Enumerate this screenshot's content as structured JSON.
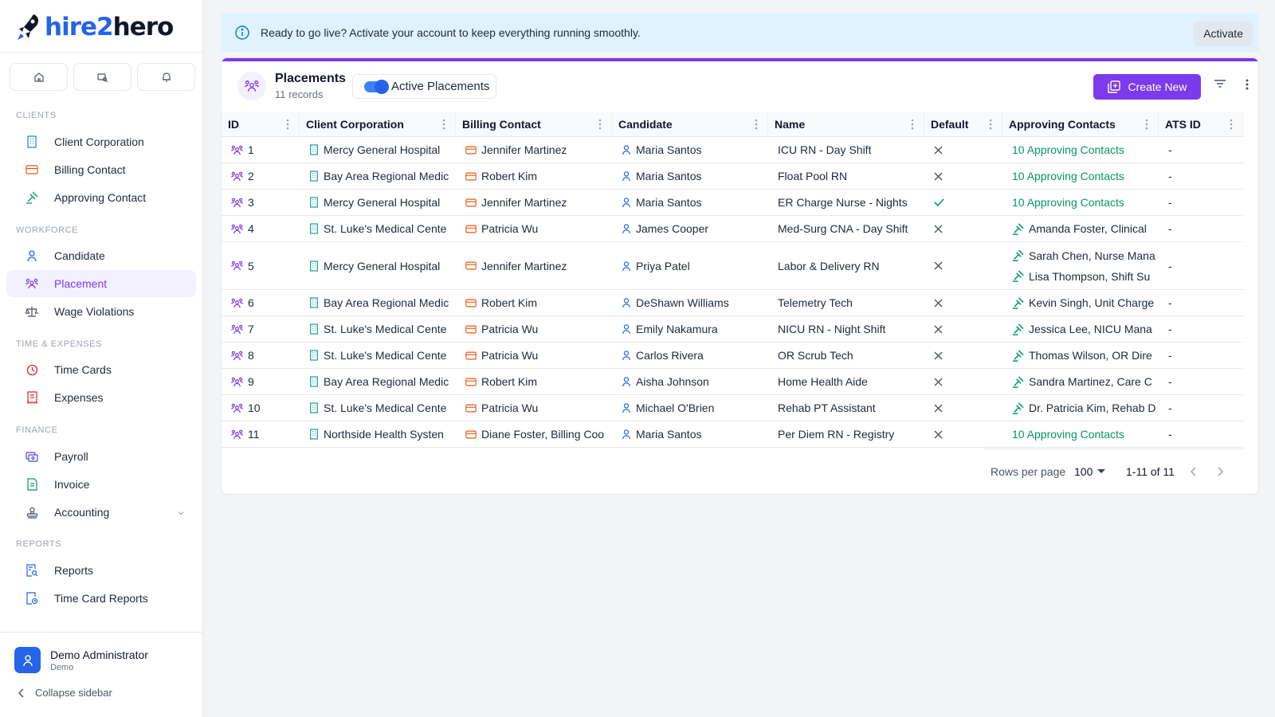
{
  "brand": {
    "name_part1": "hire",
    "name_part2": "2",
    "name_part3": "hero"
  },
  "quick_actions": [
    "home-icon",
    "search-icon",
    "bell-icon"
  ],
  "sidebar": {
    "sections": [
      {
        "label": "CLIENTS",
        "items": [
          {
            "label": "Client Corporation",
            "icon": "building-icon",
            "color": "#0d9488"
          },
          {
            "label": "Billing Contact",
            "icon": "credit-card-icon",
            "color": "#ea580c"
          },
          {
            "label": "Approving Contact",
            "icon": "approval-icon",
            "color": "#059669"
          }
        ]
      },
      {
        "label": "WORKFORCE",
        "items": [
          {
            "label": "Candidate",
            "icon": "user-icon",
            "color": "#2563eb"
          },
          {
            "label": "Placement",
            "icon": "users-icon",
            "color": "#7c3aed",
            "active": true
          },
          {
            "label": "Wage Violations",
            "icon": "scale-icon",
            "color": "#4b5563"
          }
        ]
      },
      {
        "label": "TIME & EXPENSES",
        "items": [
          {
            "label": "Time Cards",
            "icon": "clock-icon",
            "color": "#dc2626"
          },
          {
            "label": "Expenses",
            "icon": "receipt-icon",
            "color": "#dc2626"
          }
        ]
      },
      {
        "label": "FINANCE",
        "items": [
          {
            "label": "Payroll",
            "icon": "payroll-icon",
            "color": "#4f46e5"
          },
          {
            "label": "Invoice",
            "icon": "invoice-icon",
            "color": "#059669"
          },
          {
            "label": "Accounting",
            "icon": "stamp-icon",
            "color": "#4b5563"
          }
        ]
      },
      {
        "label": "REPORTS",
        "items": [
          {
            "label": "Reports",
            "icon": "report-icon",
            "color": "#2563eb"
          },
          {
            "label": "Time Card Reports",
            "icon": "timecard-report-icon",
            "color": "#2563eb"
          }
        ]
      }
    ],
    "user": {
      "name": "Demo Administrator",
      "role": "Demo"
    },
    "collapse_label": "Collapse sidebar"
  },
  "banner": {
    "message": "Ready to go live? Activate your account to keep everything running smoothly.",
    "button": "Activate"
  },
  "page": {
    "title": "Placements",
    "subtitle": "11 records",
    "toggle_label": "Active Placements",
    "toggle_on": true,
    "create_button": "Create New"
  },
  "table": {
    "columns": [
      "ID",
      "Client Corporation",
      "Billing Contact",
      "Candidate",
      "Name",
      "Default",
      "Approving Contacts",
      "ATS ID"
    ],
    "rows": [
      {
        "id": "1",
        "client": "Mercy General Hospital",
        "billing": "Jennifer Martinez",
        "candidate": "Maria Santos",
        "name": "ICU RN - Day Shift",
        "default": false,
        "approving": [
          "10 Approving Contacts"
        ],
        "approving_is_link": true,
        "ats": "-"
      },
      {
        "id": "2",
        "client": "Bay Area Regional Medic",
        "billing": "Robert Kim",
        "candidate": "Maria Santos",
        "name": "Float Pool RN",
        "default": false,
        "approving": [
          "10 Approving Contacts"
        ],
        "approving_is_link": true,
        "ats": "-"
      },
      {
        "id": "3",
        "client": "Mercy General Hospital",
        "billing": "Jennifer Martinez",
        "candidate": "Maria Santos",
        "name": "ER Charge Nurse - Nights",
        "default": true,
        "approving": [
          "10 Approving Contacts"
        ],
        "approving_is_link": true,
        "ats": "-"
      },
      {
        "id": "4",
        "client": "St. Luke's Medical Cente",
        "billing": "Patricia Wu",
        "candidate": "James Cooper",
        "name": "Med-Surg CNA - Day Shift",
        "default": false,
        "approving": [
          "Amanda Foster, Clinical"
        ],
        "approving_is_link": false,
        "ats": "-"
      },
      {
        "id": "5",
        "client": "Mercy General Hospital",
        "billing": "Jennifer Martinez",
        "candidate": "Priya Patel",
        "name": "Labor & Delivery RN",
        "default": false,
        "approving": [
          "Sarah Chen, Nurse Mana",
          "Lisa Thompson, Shift Su"
        ],
        "approving_is_link": false,
        "ats": "-"
      },
      {
        "id": "6",
        "client": "Bay Area Regional Medic",
        "billing": "Robert Kim",
        "candidate": "DeShawn Williams",
        "name": "Telemetry Tech",
        "default": false,
        "approving": [
          "Kevin Singh, Unit Charge"
        ],
        "approving_is_link": false,
        "ats": "-"
      },
      {
        "id": "7",
        "client": "St. Luke's Medical Cente",
        "billing": "Patricia Wu",
        "candidate": "Emily Nakamura",
        "name": "NICU RN - Night Shift",
        "default": false,
        "approving": [
          "Jessica Lee, NICU Mana"
        ],
        "approving_is_link": false,
        "ats": "-"
      },
      {
        "id": "8",
        "client": "St. Luke's Medical Cente",
        "billing": "Patricia Wu",
        "candidate": "Carlos Rivera",
        "name": "OR Scrub Tech",
        "default": false,
        "approving": [
          "Thomas Wilson, OR Dire"
        ],
        "approving_is_link": false,
        "ats": "-"
      },
      {
        "id": "9",
        "client": "Bay Area Regional Medic",
        "billing": "Robert Kim",
        "candidate": "Aisha Johnson",
        "name": "Home Health Aide",
        "default": false,
        "approving": [
          "Sandra Martinez, Care C"
        ],
        "approving_is_link": false,
        "ats": "-"
      },
      {
        "id": "10",
        "client": "St. Luke's Medical Cente",
        "billing": "Patricia Wu",
        "candidate": "Michael O'Brien",
        "name": "Rehab PT Assistant",
        "default": false,
        "approving": [
          "Dr. Patricia Kim, Rehab D"
        ],
        "approving_is_link": false,
        "ats": "-"
      },
      {
        "id": "11",
        "client": "Northside Health Systen",
        "billing": "Diane Foster, Billing Coo",
        "candidate": "Maria Santos",
        "name": "Per Diem RN - Registry",
        "default": false,
        "approving": [
          "10 Approving Contacts"
        ],
        "approving_is_link": true,
        "ats": "-"
      }
    ]
  },
  "pagination": {
    "rows_per_page_label": "Rows per page",
    "rows_per_page": "100",
    "range": "1-11 of 11"
  },
  "colors": {
    "accent": "#7c3aed",
    "link_green": "#059669",
    "banner_bg": "#e0f2fe"
  }
}
